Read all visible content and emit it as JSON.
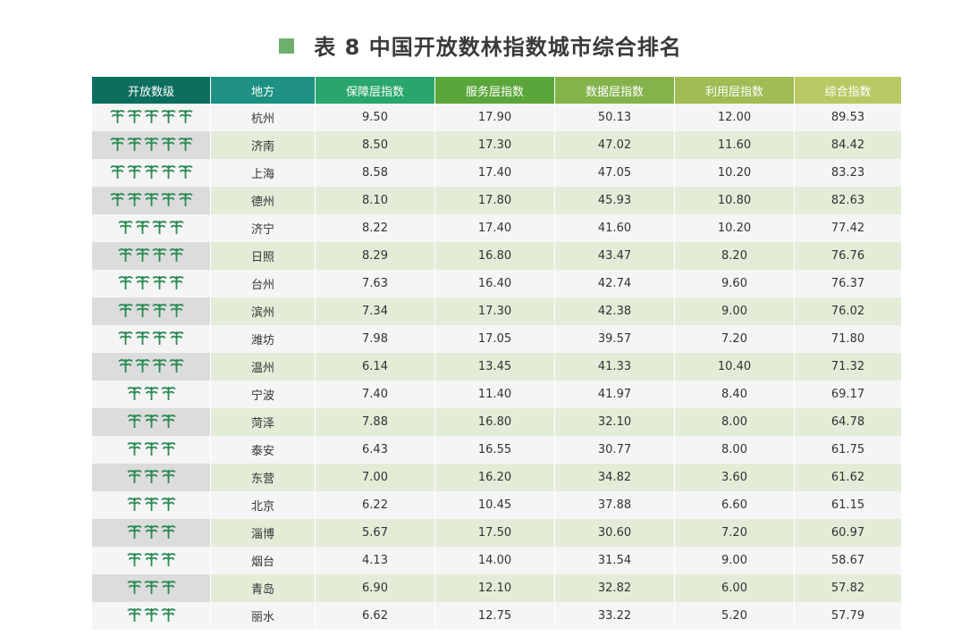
{
  "title": "表 8  中国开放数林指数城市综合排名",
  "colors": {
    "title_square": "#6fb06f",
    "tree": "#2a8a54"
  },
  "headers": [
    {
      "label": "开放数级",
      "color": "#0e6e5e"
    },
    {
      "label": "地方",
      "color": "#1e9182"
    },
    {
      "label": "保障层指数",
      "color": "#29a66b"
    },
    {
      "label": "服务层指数",
      "color": "#5ba63b"
    },
    {
      "label": "数据层指数",
      "color": "#84b34c"
    },
    {
      "label": "利用层指数",
      "color": "#9fbc55"
    },
    {
      "label": "综合指数",
      "color": "#bac864"
    }
  ],
  "rows": [
    {
      "trees": 5,
      "city": "杭州",
      "v1": "9.50",
      "v2": "17.90",
      "v3": "50.13",
      "v4": "12.00",
      "total": "89.53"
    },
    {
      "trees": 5,
      "city": "济南",
      "v1": "8.50",
      "v2": "17.30",
      "v3": "47.02",
      "v4": "11.60",
      "total": "84.42"
    },
    {
      "trees": 5,
      "city": "上海",
      "v1": "8.58",
      "v2": "17.40",
      "v3": "47.05",
      "v4": "10.20",
      "total": "83.23"
    },
    {
      "trees": 5,
      "city": "德州",
      "v1": "8.10",
      "v2": "17.80",
      "v3": "45.93",
      "v4": "10.80",
      "total": "82.63"
    },
    {
      "trees": 4,
      "city": "济宁",
      "v1": "8.22",
      "v2": "17.40",
      "v3": "41.60",
      "v4": "10.20",
      "total": "77.42"
    },
    {
      "trees": 4,
      "city": "日照",
      "v1": "8.29",
      "v2": "16.80",
      "v3": "43.47",
      "v4": "8.20",
      "total": "76.76"
    },
    {
      "trees": 4,
      "city": "台州",
      "v1": "7.63",
      "v2": "16.40",
      "v3": "42.74",
      "v4": "9.60",
      "total": "76.37"
    },
    {
      "trees": 4,
      "city": "滨州",
      "v1": "7.34",
      "v2": "17.30",
      "v3": "42.38",
      "v4": "9.00",
      "total": "76.02"
    },
    {
      "trees": 4,
      "city": "潍坊",
      "v1": "7.98",
      "v2": "17.05",
      "v3": "39.57",
      "v4": "7.20",
      "total": "71.80"
    },
    {
      "trees": 4,
      "city": "温州",
      "v1": "6.14",
      "v2": "13.45",
      "v3": "41.33",
      "v4": "10.40",
      "total": "71.32"
    },
    {
      "trees": 3,
      "city": "宁波",
      "v1": "7.40",
      "v2": "11.40",
      "v3": "41.97",
      "v4": "8.40",
      "total": "69.17"
    },
    {
      "trees": 3,
      "city": "菏泽",
      "v1": "7.88",
      "v2": "16.80",
      "v3": "32.10",
      "v4": "8.00",
      "total": "64.78"
    },
    {
      "trees": 3,
      "city": "泰安",
      "v1": "6.43",
      "v2": "16.55",
      "v3": "30.77",
      "v4": "8.00",
      "total": "61.75"
    },
    {
      "trees": 3,
      "city": "东营",
      "v1": "7.00",
      "v2": "16.20",
      "v3": "34.82",
      "v4": "3.60",
      "total": "61.62"
    },
    {
      "trees": 3,
      "city": "北京",
      "v1": "6.22",
      "v2": "10.45",
      "v3": "37.88",
      "v4": "6.60",
      "total": "61.15"
    },
    {
      "trees": 3,
      "city": "淄博",
      "v1": "5.67",
      "v2": "17.50",
      "v3": "30.60",
      "v4": "7.20",
      "total": "60.97"
    },
    {
      "trees": 3,
      "city": "烟台",
      "v1": "4.13",
      "v2": "14.00",
      "v3": "31.54",
      "v4": "9.00",
      "total": "58.67"
    },
    {
      "trees": 3,
      "city": "青岛",
      "v1": "6.90",
      "v2": "12.10",
      "v3": "32.82",
      "v4": "6.00",
      "total": "57.82"
    },
    {
      "trees": 3,
      "city": "丽水",
      "v1": "6.62",
      "v2": "12.75",
      "v3": "33.22",
      "v4": "5.20",
      "total": "57.79"
    }
  ]
}
